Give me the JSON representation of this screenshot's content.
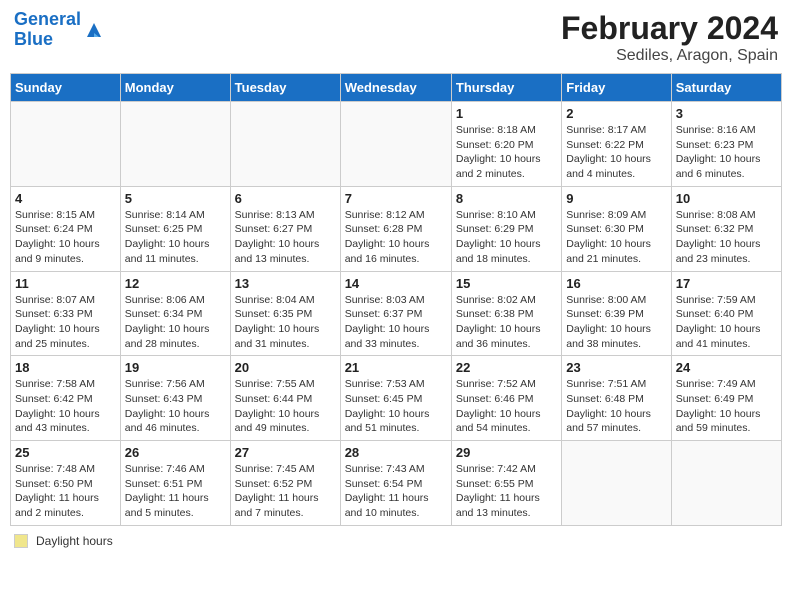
{
  "header": {
    "logo_general": "General",
    "logo_blue": "Blue",
    "month": "February 2024",
    "location": "Sediles, Aragon, Spain"
  },
  "weekdays": [
    "Sunday",
    "Monday",
    "Tuesday",
    "Wednesday",
    "Thursday",
    "Friday",
    "Saturday"
  ],
  "weeks": [
    [
      {
        "day": "",
        "info": ""
      },
      {
        "day": "",
        "info": ""
      },
      {
        "day": "",
        "info": ""
      },
      {
        "day": "",
        "info": ""
      },
      {
        "day": "1",
        "info": "Sunrise: 8:18 AM\nSunset: 6:20 PM\nDaylight: 10 hours\nand 2 minutes."
      },
      {
        "day": "2",
        "info": "Sunrise: 8:17 AM\nSunset: 6:22 PM\nDaylight: 10 hours\nand 4 minutes."
      },
      {
        "day": "3",
        "info": "Sunrise: 8:16 AM\nSunset: 6:23 PM\nDaylight: 10 hours\nand 6 minutes."
      }
    ],
    [
      {
        "day": "4",
        "info": "Sunrise: 8:15 AM\nSunset: 6:24 PM\nDaylight: 10 hours\nand 9 minutes."
      },
      {
        "day": "5",
        "info": "Sunrise: 8:14 AM\nSunset: 6:25 PM\nDaylight: 10 hours\nand 11 minutes."
      },
      {
        "day": "6",
        "info": "Sunrise: 8:13 AM\nSunset: 6:27 PM\nDaylight: 10 hours\nand 13 minutes."
      },
      {
        "day": "7",
        "info": "Sunrise: 8:12 AM\nSunset: 6:28 PM\nDaylight: 10 hours\nand 16 minutes."
      },
      {
        "day": "8",
        "info": "Sunrise: 8:10 AM\nSunset: 6:29 PM\nDaylight: 10 hours\nand 18 minutes."
      },
      {
        "day": "9",
        "info": "Sunrise: 8:09 AM\nSunset: 6:30 PM\nDaylight: 10 hours\nand 21 minutes."
      },
      {
        "day": "10",
        "info": "Sunrise: 8:08 AM\nSunset: 6:32 PM\nDaylight: 10 hours\nand 23 minutes."
      }
    ],
    [
      {
        "day": "11",
        "info": "Sunrise: 8:07 AM\nSunset: 6:33 PM\nDaylight: 10 hours\nand 25 minutes."
      },
      {
        "day": "12",
        "info": "Sunrise: 8:06 AM\nSunset: 6:34 PM\nDaylight: 10 hours\nand 28 minutes."
      },
      {
        "day": "13",
        "info": "Sunrise: 8:04 AM\nSunset: 6:35 PM\nDaylight: 10 hours\nand 31 minutes."
      },
      {
        "day": "14",
        "info": "Sunrise: 8:03 AM\nSunset: 6:37 PM\nDaylight: 10 hours\nand 33 minutes."
      },
      {
        "day": "15",
        "info": "Sunrise: 8:02 AM\nSunset: 6:38 PM\nDaylight: 10 hours\nand 36 minutes."
      },
      {
        "day": "16",
        "info": "Sunrise: 8:00 AM\nSunset: 6:39 PM\nDaylight: 10 hours\nand 38 minutes."
      },
      {
        "day": "17",
        "info": "Sunrise: 7:59 AM\nSunset: 6:40 PM\nDaylight: 10 hours\nand 41 minutes."
      }
    ],
    [
      {
        "day": "18",
        "info": "Sunrise: 7:58 AM\nSunset: 6:42 PM\nDaylight: 10 hours\nand 43 minutes."
      },
      {
        "day": "19",
        "info": "Sunrise: 7:56 AM\nSunset: 6:43 PM\nDaylight: 10 hours\nand 46 minutes."
      },
      {
        "day": "20",
        "info": "Sunrise: 7:55 AM\nSunset: 6:44 PM\nDaylight: 10 hours\nand 49 minutes."
      },
      {
        "day": "21",
        "info": "Sunrise: 7:53 AM\nSunset: 6:45 PM\nDaylight: 10 hours\nand 51 minutes."
      },
      {
        "day": "22",
        "info": "Sunrise: 7:52 AM\nSunset: 6:46 PM\nDaylight: 10 hours\nand 54 minutes."
      },
      {
        "day": "23",
        "info": "Sunrise: 7:51 AM\nSunset: 6:48 PM\nDaylight: 10 hours\nand 57 minutes."
      },
      {
        "day": "24",
        "info": "Sunrise: 7:49 AM\nSunset: 6:49 PM\nDaylight: 10 hours\nand 59 minutes."
      }
    ],
    [
      {
        "day": "25",
        "info": "Sunrise: 7:48 AM\nSunset: 6:50 PM\nDaylight: 11 hours\nand 2 minutes."
      },
      {
        "day": "26",
        "info": "Sunrise: 7:46 AM\nSunset: 6:51 PM\nDaylight: 11 hours\nand 5 minutes."
      },
      {
        "day": "27",
        "info": "Sunrise: 7:45 AM\nSunset: 6:52 PM\nDaylight: 11 hours\nand 7 minutes."
      },
      {
        "day": "28",
        "info": "Sunrise: 7:43 AM\nSunset: 6:54 PM\nDaylight: 11 hours\nand 10 minutes."
      },
      {
        "day": "29",
        "info": "Sunrise: 7:42 AM\nSunset: 6:55 PM\nDaylight: 11 hours\nand 13 minutes."
      },
      {
        "day": "",
        "info": ""
      },
      {
        "day": "",
        "info": ""
      }
    ]
  ],
  "footer": {
    "legend_label": "Daylight hours"
  }
}
